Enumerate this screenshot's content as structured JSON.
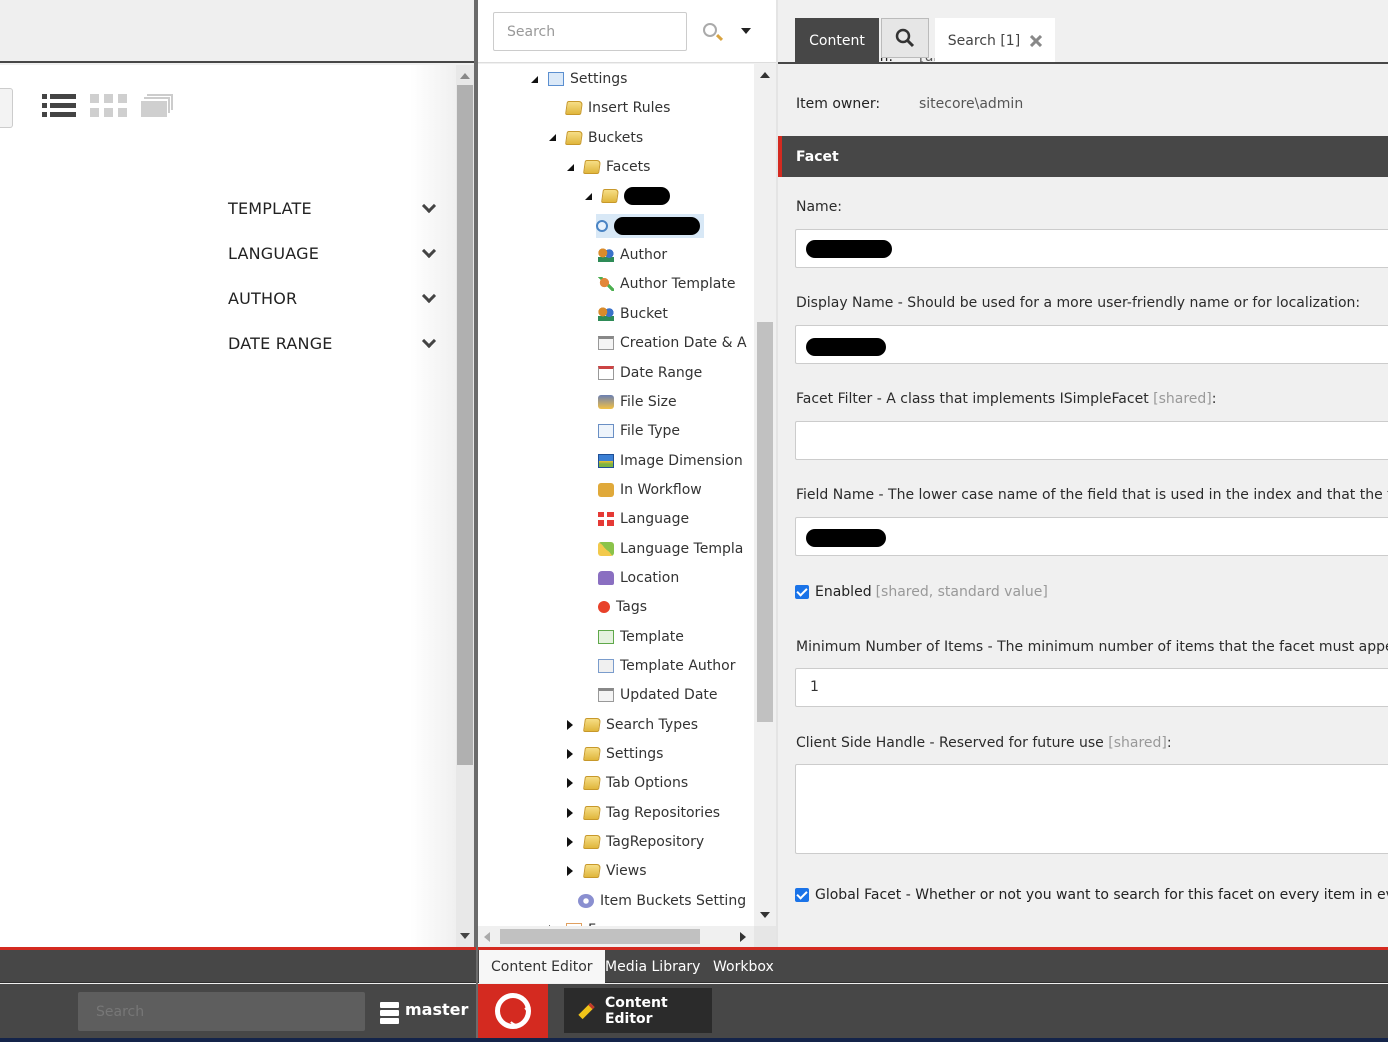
{
  "left_panel": {
    "view_icons": [
      "list-view-icon",
      "grid-view-icon",
      "stack-view-icon"
    ],
    "facets": [
      {
        "label": "TEMPLATE"
      },
      {
        "label": "LANGUAGE"
      },
      {
        "label": "AUTHOR"
      },
      {
        "label": "DATE RANGE"
      }
    ]
  },
  "tree": {
    "search_placeholder": "Search",
    "nodes": [
      {
        "label": "Settings",
        "icon": "settings-checklist-icon",
        "state": "open"
      },
      {
        "label": "Insert Rules",
        "icon": "folder-icon",
        "state": "none"
      },
      {
        "label": "Buckets",
        "icon": "folder-icon",
        "state": "open"
      },
      {
        "label": "Facets",
        "icon": "folder-icon",
        "state": "open"
      },
      {
        "label": "",
        "icon": "folder-icon",
        "state": "open",
        "redacted": true
      },
      {
        "label": "",
        "icon": "magnifier-icon",
        "state": "none",
        "redacted": true,
        "selected": true
      },
      {
        "label": "Author",
        "icon": "users-icon",
        "state": "none"
      },
      {
        "label": "Author Template",
        "icon": "user-edit-icon",
        "state": "none"
      },
      {
        "label": "Bucket",
        "icon": "users-icon",
        "state": "none"
      },
      {
        "label": "Creation Date & A",
        "icon": "calendar-warning-icon",
        "state": "none"
      },
      {
        "label": "Date Range",
        "icon": "calendar-icon",
        "state": "none"
      },
      {
        "label": "File Size",
        "icon": "file-size-icon",
        "state": "none"
      },
      {
        "label": "File Type",
        "icon": "audio-file-icon",
        "state": "none"
      },
      {
        "label": "Image Dimension",
        "icon": "image-icon",
        "state": "none"
      },
      {
        "label": "In Workflow",
        "icon": "package-icon",
        "state": "none"
      },
      {
        "label": "Language",
        "icon": "flag-icon",
        "state": "none"
      },
      {
        "label": "Language Templa",
        "icon": "language-template-icon",
        "state": "none"
      },
      {
        "label": "Location",
        "icon": "location-icon",
        "state": "none"
      },
      {
        "label": "Tags",
        "icon": "red-dot-icon",
        "state": "none"
      },
      {
        "label": "Template",
        "icon": "template-icon",
        "state": "none"
      },
      {
        "label": "Template Author",
        "icon": "template-author-icon",
        "state": "none"
      },
      {
        "label": "Updated Date",
        "icon": "calendar-warning-icon",
        "state": "none"
      },
      {
        "label": "Search Types",
        "icon": "folder-icon",
        "state": "closed"
      },
      {
        "label": "Settings",
        "icon": "folder-icon",
        "state": "closed"
      },
      {
        "label": "Tab Options",
        "icon": "folder-icon",
        "state": "closed"
      },
      {
        "label": "Tag Repositories",
        "icon": "folder-icon",
        "state": "closed"
      },
      {
        "label": "TagRepository",
        "icon": "folder-icon",
        "state": "closed"
      },
      {
        "label": "Views",
        "icon": "folder-icon",
        "state": "closed"
      },
      {
        "label": "Item Buckets Setting",
        "icon": "gear-icon",
        "state": "none"
      },
      {
        "label": "Forms",
        "icon": "forms-icon",
        "state": "closed"
      }
    ]
  },
  "editor": {
    "tabs": {
      "content": "Content",
      "search_tab": "Search [1]"
    },
    "properties": [
      {
        "key": "Created from:",
        "value": "[unknown]"
      },
      {
        "key": "Item owner:",
        "value": "sitecore\\admin"
      }
    ],
    "section_title": "Facet",
    "fields": {
      "name_label": "Name:",
      "display_name_label": "Display Name - Should be used for a more user-friendly name or for localization:",
      "facet_filter_label": "Facet Filter - A class that implements ISimpleFacet",
      "facet_filter_note": "[shared]",
      "field_name_label": "Field Name - The lower case name of the field that is used in the index and that the facet is bas",
      "enabled_label": "Enabled",
      "enabled_note": "[shared, standard value]",
      "enabled_checked": true,
      "min_items_label": "Minimum Number of Items - The minimum number of items that the facet must appear in befo",
      "min_items_value": "1",
      "client_handle_label": "Client Side Handle - Reserved for future use",
      "client_handle_note": "[shared]",
      "client_handle_value": "",
      "facet_filter_value": "",
      "global_facet_label": "Global Facet - Whether or not you want to search for this facet on every item in every search",
      "global_facet_checked": true
    }
  },
  "bottom": {
    "tabs": [
      "Content Editor",
      "Media Library",
      "Workbox"
    ],
    "active_tab": "Content Editor",
    "search_placeholder": "Search",
    "database": "master",
    "app_button": "Content Editor"
  },
  "colors": {
    "accent_red": "#d42a20",
    "dark_bar": "#474747",
    "checkbox_blue": "#1a73e8"
  }
}
